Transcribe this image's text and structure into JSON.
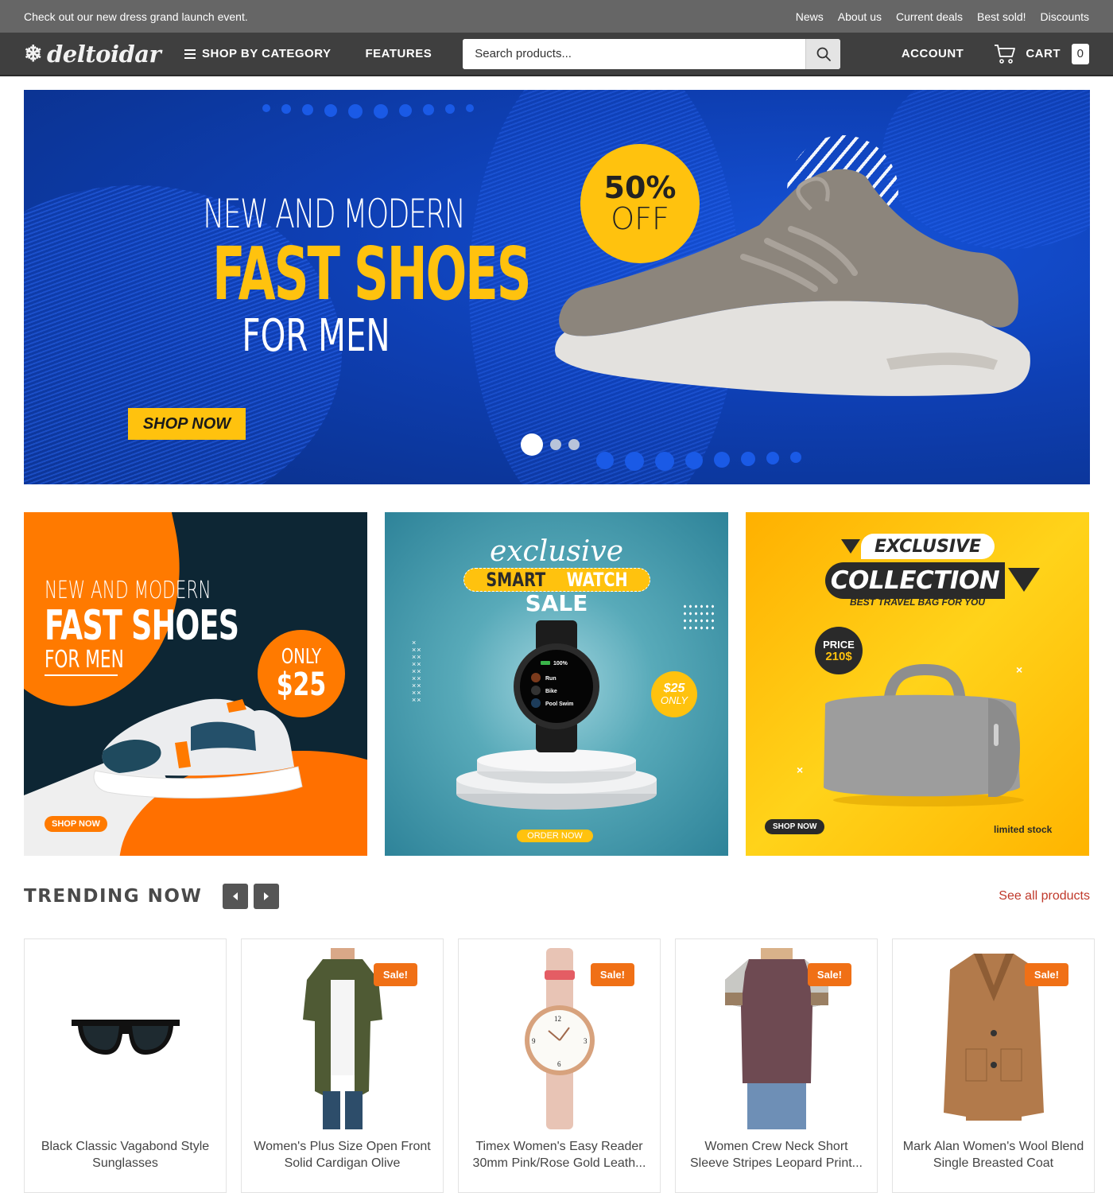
{
  "topbar": {
    "announcement": "Check out our new dress grand launch event.",
    "links": [
      "News",
      "About us",
      "Current deals",
      "Best sold!",
      "Discounts"
    ]
  },
  "nav": {
    "logo": "deltoidar",
    "logo_icon": "snowflake-icon",
    "shop_by_category": "SHOP BY CATEGORY",
    "features": "FEATURES",
    "search_placeholder": "Search products...",
    "search_value": "",
    "account": "ACCOUNT",
    "cart_label": "CART",
    "cart_count": "0"
  },
  "hero": {
    "line1": "NEW AND MODERN",
    "line2": "FAST SHOES",
    "line3": "FOR MEN",
    "cta": "SHOP NOW",
    "badge_top": "50%",
    "badge_bottom": "OFF",
    "slides_total": 3,
    "slide_active": 1,
    "colors": {
      "bg": "#0e3fb3",
      "accent": "#ffc20e"
    }
  },
  "promos": [
    {
      "line1": "NEW AND MODERN",
      "line2": "FAST SHOES",
      "line3": "FOR MEN",
      "badge_top": "ONLY",
      "badge_bottom": "$25",
      "cta": "SHOP NOW"
    },
    {
      "script": "exclusive",
      "title_a": "SMART",
      "title_b": "WATCH",
      "subtitle": "SALE",
      "watch_lines": [
        "100%",
        "Run",
        "Bike",
        "Pool Swim"
      ],
      "price_top": "$25",
      "price_bottom": "ONLY",
      "cta": "ORDER NOW"
    },
    {
      "line1": "EXCLUSIVE",
      "line2": "COLLECTION",
      "subtitle": "BEST TRAVEL BAG FOR YOU",
      "price_top": "PRICE",
      "price_bottom": "210$",
      "cta": "SHOP NOW",
      "note": "limited stock"
    }
  ],
  "trending": {
    "title": "TRENDING NOW",
    "see_all": "See all products",
    "products": [
      {
        "name": "Black Classic Vagabond Style Sunglasses",
        "sale": false,
        "sale_label": ""
      },
      {
        "name": "Women's Plus Size Open Front Solid Cardigan Olive",
        "sale": true,
        "sale_label": "Sale!"
      },
      {
        "name": "Timex Women's Easy Reader 30mm Pink/Rose Gold Leath...",
        "sale": true,
        "sale_label": "Sale!"
      },
      {
        "name": "Women Crew Neck Short Sleeve Stripes Leopard Print...",
        "sale": true,
        "sale_label": "Sale!"
      },
      {
        "name": "Mark Alan Women's Wool Blend Single Breasted Coat",
        "sale": true,
        "sale_label": "Sale!"
      }
    ]
  }
}
